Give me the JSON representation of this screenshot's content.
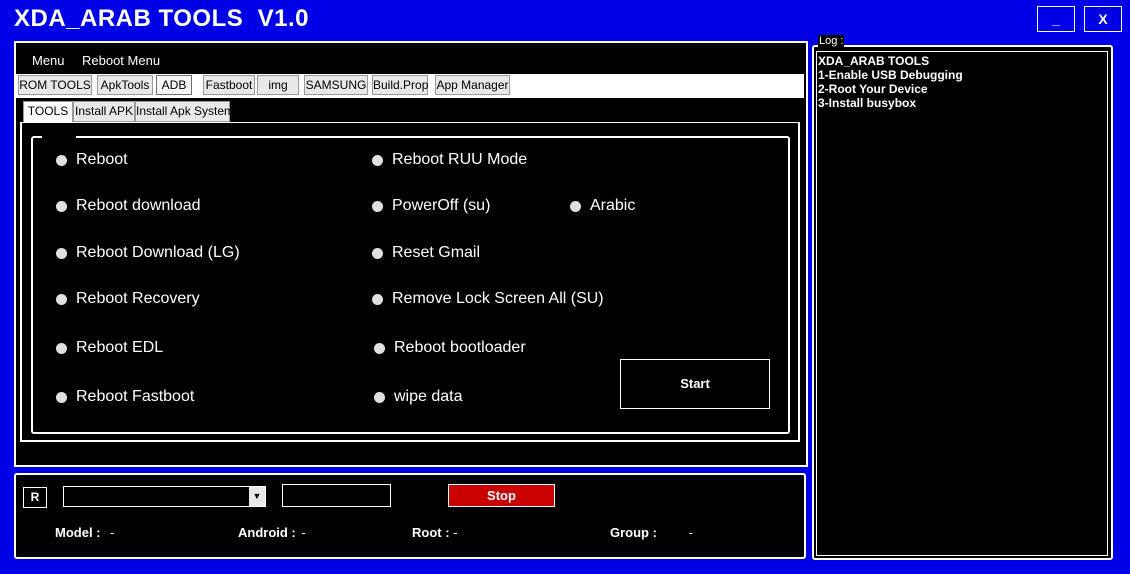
{
  "window": {
    "title": "XDA_ARAB TOOLS  V1.0",
    "minimize_label": "_",
    "close_label": "X"
  },
  "menu": {
    "items": [
      "Menu",
      "Reboot Menu"
    ]
  },
  "tabs": {
    "items": [
      "ROM TOOLS",
      "ApkTools",
      "ADB",
      "Fastboot",
      "img",
      "SAMSUNG",
      "Build.Prop",
      "App Manager"
    ],
    "active": "ADB"
  },
  "subtabs": {
    "items": [
      "TOOLS",
      "Install APK",
      "Install Apk System"
    ],
    "active": "TOOLS"
  },
  "options": [
    "Reboot",
    "Reboot download",
    "Reboot Download (LG)",
    "Reboot Recovery",
    "Reboot EDL",
    "Reboot Fastboot",
    "Reboot RUU Mode",
    "PowerOff (su)",
    "Reset Gmail",
    "Remove Lock Screen All (SU)",
    "Reboot bootloader",
    "wipe data",
    "Arabic"
  ],
  "start_label": "Start",
  "bottom": {
    "r_label": "R",
    "device_select_value": "",
    "text_input_value": "",
    "stop_label": "Stop",
    "info": {
      "model_label": "Model :",
      "model_value": "-",
      "android_label": "Android :",
      "android_value": "-",
      "root_label": "Root :",
      "root_value": "-",
      "group_label": "Group :",
      "group_value": "-"
    }
  },
  "log": {
    "title": "Log :",
    "lines": [
      "XDA_ARAB TOOLS",
      "1-Enable USB Debugging",
      "2-Root Your Device",
      "3-Install busybox"
    ]
  },
  "colors": {
    "window_bg": "#0000e6",
    "panel_bg": "#000000",
    "stop_button": "#c80000",
    "text": "#ffffff"
  },
  "icons": {
    "combo_arrow": "chevron-down-icon",
    "radio": "radio-icon"
  }
}
